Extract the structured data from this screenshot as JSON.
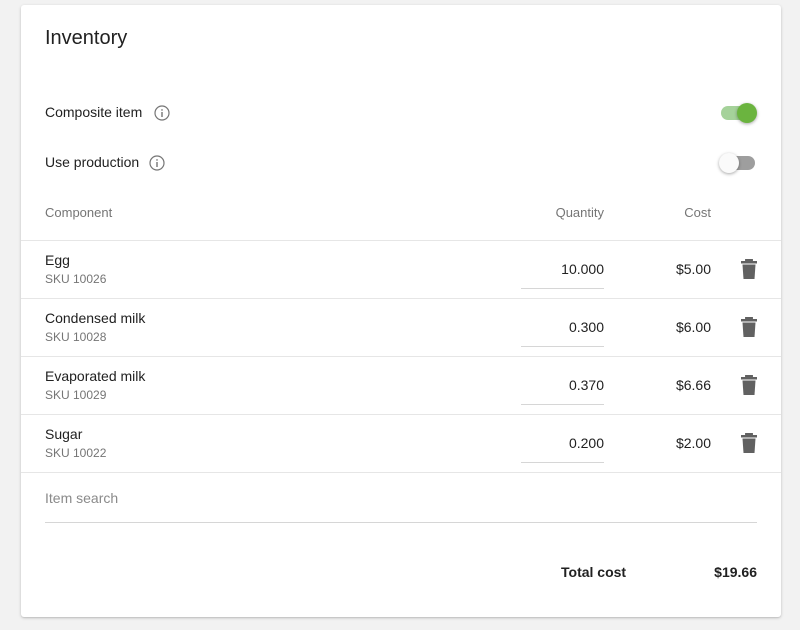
{
  "title": "Inventory",
  "settings": [
    {
      "label": "Composite item",
      "enabled": true
    },
    {
      "label": "Use production",
      "enabled": false
    }
  ],
  "columns": {
    "component": "Component",
    "quantity": "Quantity",
    "cost": "Cost"
  },
  "components": [
    {
      "name": "Egg",
      "sku": "SKU 10026",
      "quantity": "10.000",
      "cost": "$5.00"
    },
    {
      "name": "Condensed milk",
      "sku": "SKU 10028",
      "quantity": "0.300",
      "cost": "$6.00"
    },
    {
      "name": "Evaporated milk",
      "sku": "SKU 10029",
      "quantity": "0.370",
      "cost": "$6.66"
    },
    {
      "name": "Sugar",
      "sku": "SKU 10022",
      "quantity": "0.200",
      "cost": "$2.00"
    }
  ],
  "search": {
    "placeholder": "Item search",
    "value": ""
  },
  "total": {
    "label": "Total cost",
    "value": "$19.66"
  },
  "icons": {
    "info": "info-icon",
    "delete": "trash-icon"
  },
  "colors": {
    "accent": "#6bb43f",
    "accent_track": "#a5d29a",
    "toggle_off_track": "#9e9e9e"
  }
}
